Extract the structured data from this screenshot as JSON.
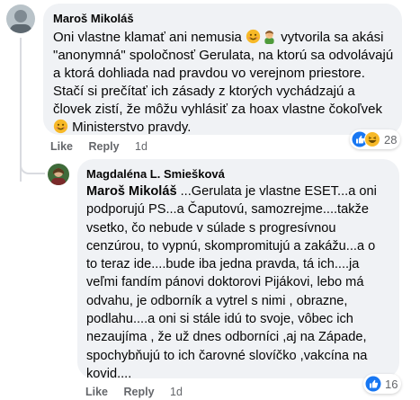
{
  "comment1": {
    "author": "Maroš Mikoláš",
    "lines": [
      {
        "pre": "Oni vlastne klamať ani nemusia ",
        "emoji1": "smile",
        "emoji2": "facepalm",
        "post": " vytvorila sa akási"
      },
      {
        "text": "\"anonymná\" spoločnosť Gerulata, na ktorú sa odvolávajú"
      },
      {
        "text": "a ktorá dohliada nad pravdou vo verejnom priestore."
      },
      {
        "text": "Stačí si prečítať ich zásady z ktorých vychádzajú a"
      },
      {
        "text": "človek zistí, že môžu vyhlásiť za hoax vlastne čokoľvek"
      },
      {
        "pre": "",
        "emoji1": "smile",
        "post": " Ministerstvo pravdy."
      }
    ],
    "actions": {
      "like": "Like",
      "reply": "Reply",
      "time": "1d"
    },
    "reactions": {
      "icons": [
        "like-icon",
        "haha-icon"
      ],
      "count": "28"
    }
  },
  "comment2": {
    "author": "Magdaléna L. Smiešková",
    "mention": "Maroš Mikoláš",
    "first_line_rest": " ...Gerulata je vlastne ESET...a oni",
    "lines": [
      "podporujú PS...a Čaputovú, samozrejme....takže",
      "vsetko, čo nebude v súlade s progresívnou",
      "cenzúrou, to vypnú, skompromitujú a zakážu...a o",
      "to teraz ide....bude iba jedna pravda, tá ich....ja",
      "veľmi fandím pánovi doktorovi Pijákovi, lebo má",
      "odvahu, je odborník a vytrel s nimi , obrazne,",
      "podlahu....a oni si stále idú to svoje, vôbec ich",
      "nezaujíma , že už dnes odborníci ,aj na Západe,",
      "spochybňujú to ich čarovné slovíčko ,vakcína na",
      "kovid...."
    ],
    "actions": {
      "like": "Like",
      "reply": "Reply",
      "time": "1d"
    },
    "reactions": {
      "icons": [
        "like-icon"
      ],
      "count": "16"
    }
  },
  "colors": {
    "bubble": "#f0f2f5",
    "meta": "#65676b",
    "like_blue": "#1877f2",
    "haha_yellow": "#f7b928"
  }
}
